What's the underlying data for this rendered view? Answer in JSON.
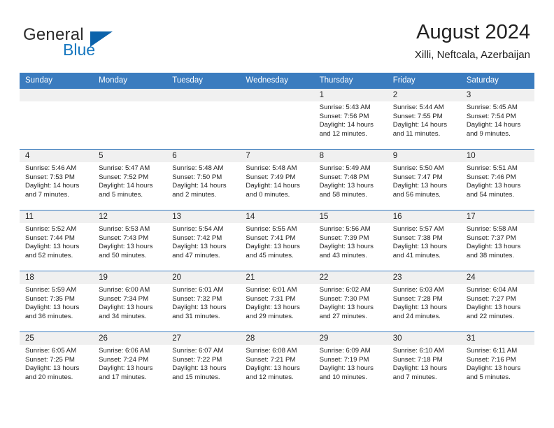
{
  "logo": {
    "word1": "General",
    "word2": "Blue",
    "triangle_color": "#0c63ab",
    "blue_text_color": "#1777bf"
  },
  "header": {
    "title": "August 2024",
    "subtitle": "Xilli, Neftcala, Azerbaijan",
    "accent_color": "#3b7cbf",
    "band_color": "#f0f0f0"
  },
  "weekday_headers": [
    "Sunday",
    "Monday",
    "Tuesday",
    "Wednesday",
    "Thursday",
    "Friday",
    "Saturday"
  ],
  "weeks": [
    [
      {
        "day": "",
        "sunrise": "",
        "sunset": "",
        "daylight1": "",
        "daylight2": ""
      },
      {
        "day": "",
        "sunrise": "",
        "sunset": "",
        "daylight1": "",
        "daylight2": ""
      },
      {
        "day": "",
        "sunrise": "",
        "sunset": "",
        "daylight1": "",
        "daylight2": ""
      },
      {
        "day": "",
        "sunrise": "",
        "sunset": "",
        "daylight1": "",
        "daylight2": ""
      },
      {
        "day": "1",
        "sunrise": "Sunrise: 5:43 AM",
        "sunset": "Sunset: 7:56 PM",
        "daylight1": "Daylight: 14 hours",
        "daylight2": "and 12 minutes."
      },
      {
        "day": "2",
        "sunrise": "Sunrise: 5:44 AM",
        "sunset": "Sunset: 7:55 PM",
        "daylight1": "Daylight: 14 hours",
        "daylight2": "and 11 minutes."
      },
      {
        "day": "3",
        "sunrise": "Sunrise: 5:45 AM",
        "sunset": "Sunset: 7:54 PM",
        "daylight1": "Daylight: 14 hours",
        "daylight2": "and 9 minutes."
      }
    ],
    [
      {
        "day": "4",
        "sunrise": "Sunrise: 5:46 AM",
        "sunset": "Sunset: 7:53 PM",
        "daylight1": "Daylight: 14 hours",
        "daylight2": "and 7 minutes."
      },
      {
        "day": "5",
        "sunrise": "Sunrise: 5:47 AM",
        "sunset": "Sunset: 7:52 PM",
        "daylight1": "Daylight: 14 hours",
        "daylight2": "and 5 minutes."
      },
      {
        "day": "6",
        "sunrise": "Sunrise: 5:48 AM",
        "sunset": "Sunset: 7:50 PM",
        "daylight1": "Daylight: 14 hours",
        "daylight2": "and 2 minutes."
      },
      {
        "day": "7",
        "sunrise": "Sunrise: 5:48 AM",
        "sunset": "Sunset: 7:49 PM",
        "daylight1": "Daylight: 14 hours",
        "daylight2": "and 0 minutes."
      },
      {
        "day": "8",
        "sunrise": "Sunrise: 5:49 AM",
        "sunset": "Sunset: 7:48 PM",
        "daylight1": "Daylight: 13 hours",
        "daylight2": "and 58 minutes."
      },
      {
        "day": "9",
        "sunrise": "Sunrise: 5:50 AM",
        "sunset": "Sunset: 7:47 PM",
        "daylight1": "Daylight: 13 hours",
        "daylight2": "and 56 minutes."
      },
      {
        "day": "10",
        "sunrise": "Sunrise: 5:51 AM",
        "sunset": "Sunset: 7:46 PM",
        "daylight1": "Daylight: 13 hours",
        "daylight2": "and 54 minutes."
      }
    ],
    [
      {
        "day": "11",
        "sunrise": "Sunrise: 5:52 AM",
        "sunset": "Sunset: 7:44 PM",
        "daylight1": "Daylight: 13 hours",
        "daylight2": "and 52 minutes."
      },
      {
        "day": "12",
        "sunrise": "Sunrise: 5:53 AM",
        "sunset": "Sunset: 7:43 PM",
        "daylight1": "Daylight: 13 hours",
        "daylight2": "and 50 minutes."
      },
      {
        "day": "13",
        "sunrise": "Sunrise: 5:54 AM",
        "sunset": "Sunset: 7:42 PM",
        "daylight1": "Daylight: 13 hours",
        "daylight2": "and 47 minutes."
      },
      {
        "day": "14",
        "sunrise": "Sunrise: 5:55 AM",
        "sunset": "Sunset: 7:41 PM",
        "daylight1": "Daylight: 13 hours",
        "daylight2": "and 45 minutes."
      },
      {
        "day": "15",
        "sunrise": "Sunrise: 5:56 AM",
        "sunset": "Sunset: 7:39 PM",
        "daylight1": "Daylight: 13 hours",
        "daylight2": "and 43 minutes."
      },
      {
        "day": "16",
        "sunrise": "Sunrise: 5:57 AM",
        "sunset": "Sunset: 7:38 PM",
        "daylight1": "Daylight: 13 hours",
        "daylight2": "and 41 minutes."
      },
      {
        "day": "17",
        "sunrise": "Sunrise: 5:58 AM",
        "sunset": "Sunset: 7:37 PM",
        "daylight1": "Daylight: 13 hours",
        "daylight2": "and 38 minutes."
      }
    ],
    [
      {
        "day": "18",
        "sunrise": "Sunrise: 5:59 AM",
        "sunset": "Sunset: 7:35 PM",
        "daylight1": "Daylight: 13 hours",
        "daylight2": "and 36 minutes."
      },
      {
        "day": "19",
        "sunrise": "Sunrise: 6:00 AM",
        "sunset": "Sunset: 7:34 PM",
        "daylight1": "Daylight: 13 hours",
        "daylight2": "and 34 minutes."
      },
      {
        "day": "20",
        "sunrise": "Sunrise: 6:01 AM",
        "sunset": "Sunset: 7:32 PM",
        "daylight1": "Daylight: 13 hours",
        "daylight2": "and 31 minutes."
      },
      {
        "day": "21",
        "sunrise": "Sunrise: 6:01 AM",
        "sunset": "Sunset: 7:31 PM",
        "daylight1": "Daylight: 13 hours",
        "daylight2": "and 29 minutes."
      },
      {
        "day": "22",
        "sunrise": "Sunrise: 6:02 AM",
        "sunset": "Sunset: 7:30 PM",
        "daylight1": "Daylight: 13 hours",
        "daylight2": "and 27 minutes."
      },
      {
        "day": "23",
        "sunrise": "Sunrise: 6:03 AM",
        "sunset": "Sunset: 7:28 PM",
        "daylight1": "Daylight: 13 hours",
        "daylight2": "and 24 minutes."
      },
      {
        "day": "24",
        "sunrise": "Sunrise: 6:04 AM",
        "sunset": "Sunset: 7:27 PM",
        "daylight1": "Daylight: 13 hours",
        "daylight2": "and 22 minutes."
      }
    ],
    [
      {
        "day": "25",
        "sunrise": "Sunrise: 6:05 AM",
        "sunset": "Sunset: 7:25 PM",
        "daylight1": "Daylight: 13 hours",
        "daylight2": "and 20 minutes."
      },
      {
        "day": "26",
        "sunrise": "Sunrise: 6:06 AM",
        "sunset": "Sunset: 7:24 PM",
        "daylight1": "Daylight: 13 hours",
        "daylight2": "and 17 minutes."
      },
      {
        "day": "27",
        "sunrise": "Sunrise: 6:07 AM",
        "sunset": "Sunset: 7:22 PM",
        "daylight1": "Daylight: 13 hours",
        "daylight2": "and 15 minutes."
      },
      {
        "day": "28",
        "sunrise": "Sunrise: 6:08 AM",
        "sunset": "Sunset: 7:21 PM",
        "daylight1": "Daylight: 13 hours",
        "daylight2": "and 12 minutes."
      },
      {
        "day": "29",
        "sunrise": "Sunrise: 6:09 AM",
        "sunset": "Sunset: 7:19 PM",
        "daylight1": "Daylight: 13 hours",
        "daylight2": "and 10 minutes."
      },
      {
        "day": "30",
        "sunrise": "Sunrise: 6:10 AM",
        "sunset": "Sunset: 7:18 PM",
        "daylight1": "Daylight: 13 hours",
        "daylight2": "and 7 minutes."
      },
      {
        "day": "31",
        "sunrise": "Sunrise: 6:11 AM",
        "sunset": "Sunset: 7:16 PM",
        "daylight1": "Daylight: 13 hours",
        "daylight2": "and 5 minutes."
      }
    ]
  ]
}
